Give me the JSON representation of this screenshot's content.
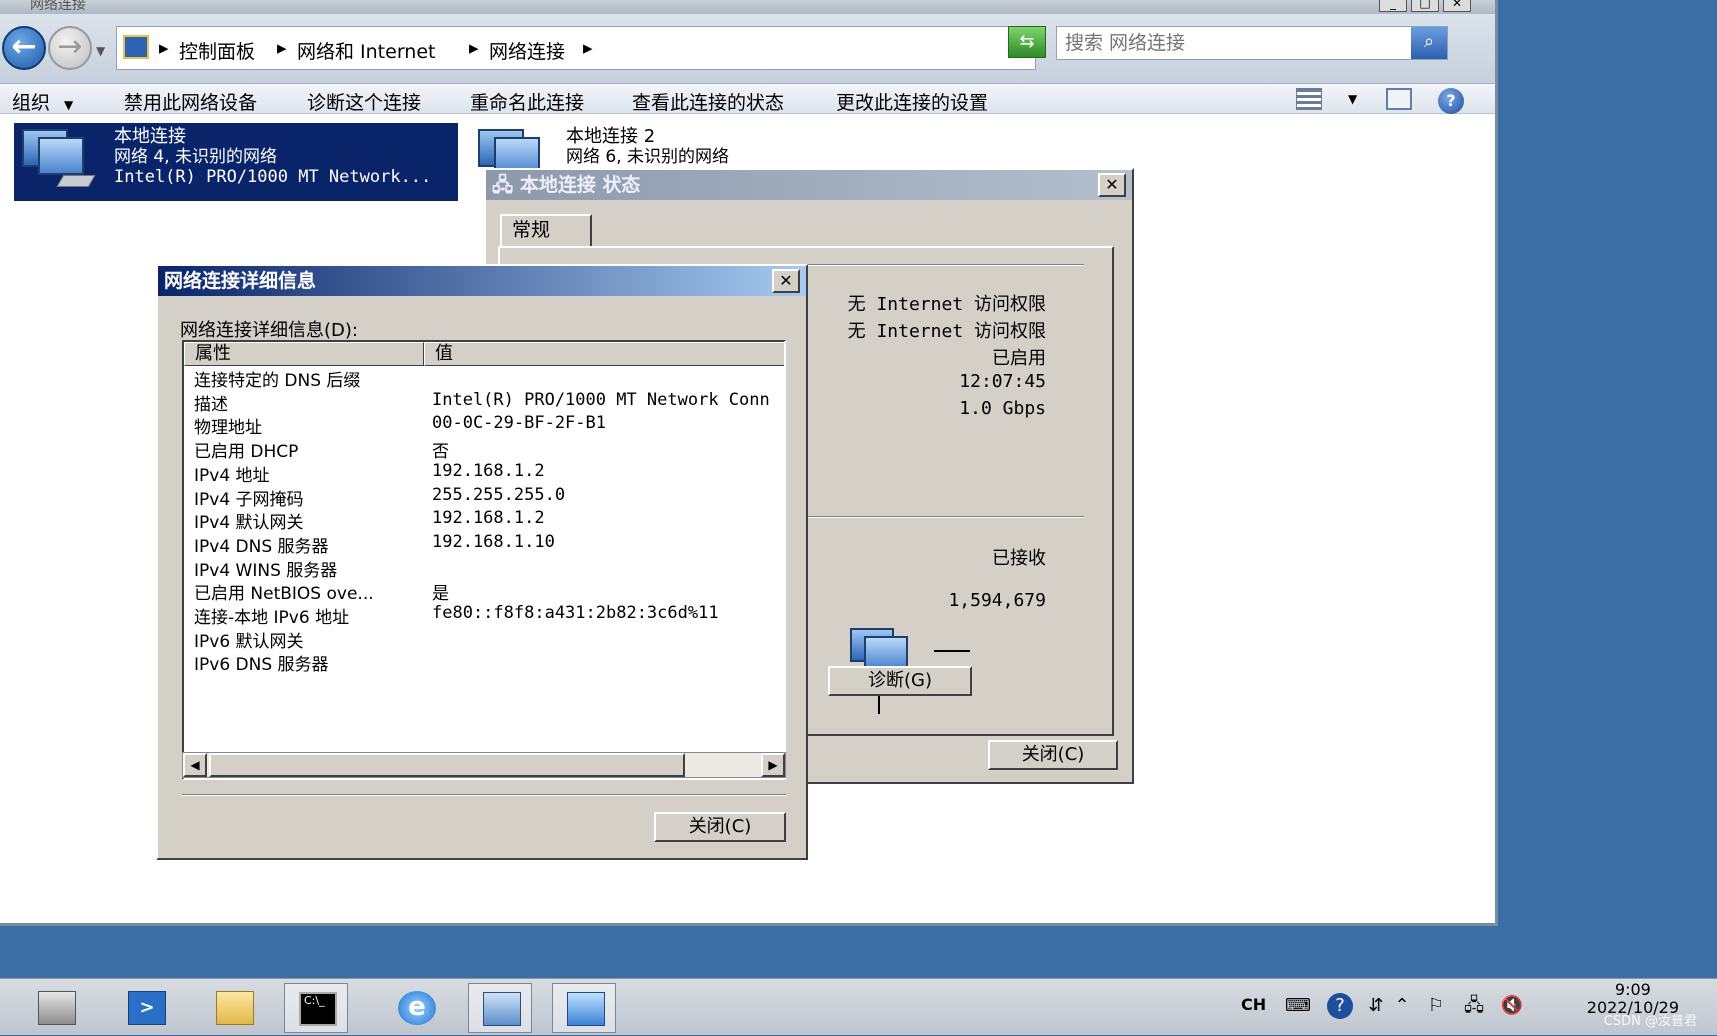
{
  "window": {
    "title": "网络连接"
  },
  "address": {
    "crumbs": [
      "控制面板",
      "网络和 Internet",
      "网络连接"
    ],
    "search_placeholder": "搜索 网络连接"
  },
  "toolbar": {
    "items": [
      "组织",
      "禁用此网络设备",
      "诊断这个连接",
      "重命名此连接",
      "查看此连接的状态",
      "更改此连接的设置"
    ]
  },
  "connections": [
    {
      "name": "本地连接",
      "network": "网络  4, 未识别的网络",
      "adapter": "Intel(R) PRO/1000 MT Network..."
    },
    {
      "name": "本地连接 2",
      "network": "网络  6, 未识别的网络"
    }
  ],
  "status_dialog": {
    "title": "本地连接 状态",
    "tab": "常规",
    "values": [
      "无 Internet 访问权限",
      "无 Internet 访问权限",
      "已启用",
      "12:07:45",
      "1.0 Gbps"
    ],
    "received_label": "已接收",
    "received_value": "1,594,679",
    "diagnose_button": "诊断(G)",
    "close_button": "关闭(C)"
  },
  "details_dialog": {
    "title": "网络连接详细信息",
    "label": "网络连接详细信息(D):",
    "col_property": "属性",
    "col_value": "值",
    "rows": [
      {
        "k": "连接特定的 DNS 后缀",
        "v": ""
      },
      {
        "k": "描述",
        "v": "Intel(R) PRO/1000 MT Network Conn"
      },
      {
        "k": "物理地址",
        "v": "00-0C-29-BF-2F-B1"
      },
      {
        "k": "已启用 DHCP",
        "v": "否"
      },
      {
        "k": "IPv4 地址",
        "v": "192.168.1.2"
      },
      {
        "k": "IPv4 子网掩码",
        "v": "255.255.255.0"
      },
      {
        "k": "IPv4 默认网关",
        "v": "192.168.1.2"
      },
      {
        "k": "IPv4 DNS 服务器",
        "v": "192.168.1.10"
      },
      {
        "k": "IPv4 WINS 服务器",
        "v": ""
      },
      {
        "k": "已启用 NetBIOS ove...",
        "v": "是"
      },
      {
        "k": "连接-本地 IPv6 地址",
        "v": "fe80::f8f8:a431:2b82:3c6d%11"
      },
      {
        "k": "IPv6 默认网关",
        "v": ""
      },
      {
        "k": "IPv6 DNS 服务器",
        "v": ""
      }
    ],
    "close_button": "关闭(C)"
  },
  "taskbar": {
    "lang": "CH",
    "time": "9:09",
    "date": "2022/10/29",
    "watermark": "CSDN @汝普君"
  }
}
